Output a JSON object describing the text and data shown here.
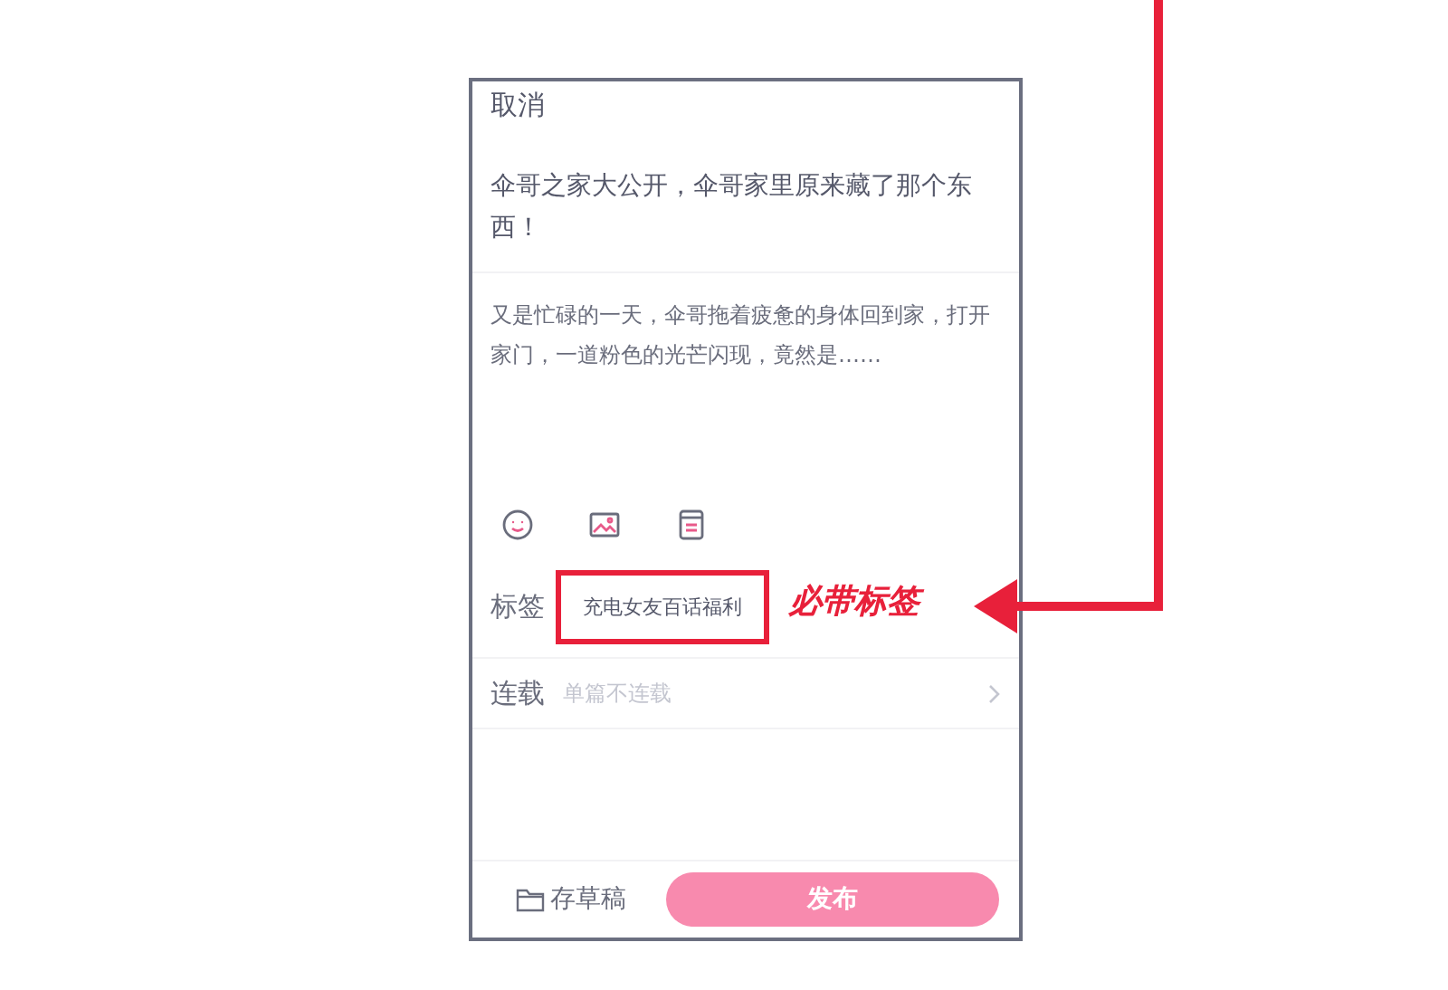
{
  "header": {
    "cancel": "取消"
  },
  "title": "伞哥之家大公开，伞哥家里原来藏了那个东西！",
  "body": "又是忙碌的一天，伞哥拖着疲惫的身体回到家，打开家门，一道粉色的光芒闪现，竟然是……",
  "tag_row": {
    "label": "标签",
    "tag": "充电女友百话福利"
  },
  "series_row": {
    "label": "连载",
    "placeholder": "单篇不连载"
  },
  "footer": {
    "draft": "存草稿",
    "publish": "发布"
  },
  "annotation": {
    "text": "必带标签"
  }
}
